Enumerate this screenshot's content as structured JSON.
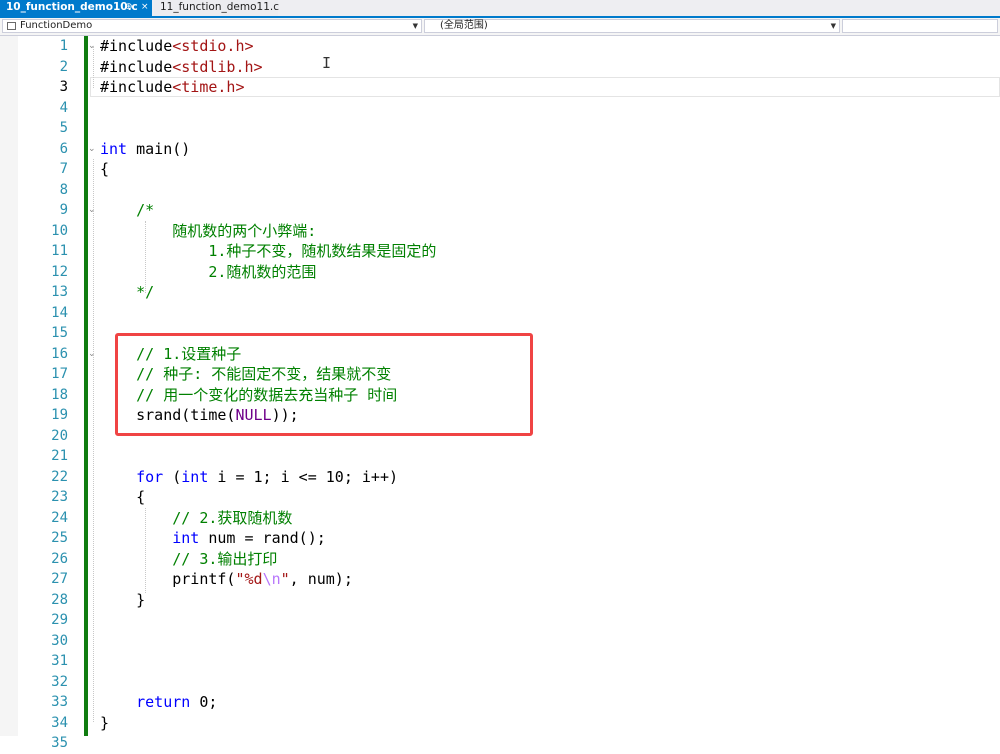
{
  "tabs": [
    {
      "label": "10_function_demo10.c",
      "pin": "⊕",
      "close": "×"
    },
    {
      "label": "11_function_demo11.c"
    }
  ],
  "nav": {
    "project": "FunctionDemo",
    "scope": "(全局范围)"
  },
  "lines": [
    [
      {
        "t": "#include",
        "c": ""
      },
      {
        "t": "<stdio.h>",
        "c": "inc"
      }
    ],
    [
      {
        "t": "#include",
        "c": ""
      },
      {
        "t": "<stdlib.h>",
        "c": "inc"
      }
    ],
    [
      {
        "t": "#include",
        "c": ""
      },
      {
        "t": "<time.h>",
        "c": "inc"
      }
    ],
    [],
    [],
    [
      {
        "t": "int",
        "c": "k"
      },
      {
        "t": " main()",
        "c": ""
      }
    ],
    [
      {
        "t": "{",
        "c": ""
      }
    ],
    [],
    [
      {
        "t": "    /*",
        "c": "cmt"
      }
    ],
    [
      {
        "t": "        随机数的两个小弊端:",
        "c": "cmt"
      }
    ],
    [
      {
        "t": "            1.种子不变，随机数结果是固定的",
        "c": "cmt"
      }
    ],
    [
      {
        "t": "            2.随机数的范围",
        "c": "cmt"
      }
    ],
    [
      {
        "t": "    */",
        "c": "cmt"
      }
    ],
    [],
    [],
    [
      {
        "t": "    // 1.设置种子",
        "c": "cmt"
      }
    ],
    [
      {
        "t": "    // 种子: 不能固定不变，结果就不变",
        "c": "cmt"
      }
    ],
    [
      {
        "t": "    // 用一个变化的数据去充当种子 时间",
        "c": "cmt"
      }
    ],
    [
      {
        "t": "    srand(time(",
        "c": ""
      },
      {
        "t": "NULL",
        "c": "mac"
      },
      {
        "t": "));",
        "c": ""
      }
    ],
    [],
    [],
    [
      {
        "t": "    ",
        "c": ""
      },
      {
        "t": "for",
        "c": "k"
      },
      {
        "t": " (",
        "c": ""
      },
      {
        "t": "int",
        "c": "k"
      },
      {
        "t": " i = 1; i <= 10; i++)",
        "c": ""
      }
    ],
    [
      {
        "t": "    {",
        "c": ""
      }
    ],
    [
      {
        "t": "        // 2.获取随机数",
        "c": "cmt"
      }
    ],
    [
      {
        "t": "        ",
        "c": ""
      },
      {
        "t": "int",
        "c": "k"
      },
      {
        "t": " num = rand();",
        "c": ""
      }
    ],
    [
      {
        "t": "        // 3.输出打印",
        "c": "cmt"
      }
    ],
    [
      {
        "t": "        printf(",
        "c": ""
      },
      {
        "t": "\"%d",
        "c": "str"
      },
      {
        "t": "\\n",
        "c": "esc"
      },
      {
        "t": "\"",
        "c": "str"
      },
      {
        "t": ", num);",
        "c": ""
      }
    ],
    [
      {
        "t": "    }",
        "c": ""
      }
    ],
    [],
    [],
    [],
    [],
    [
      {
        "t": "    ",
        "c": ""
      },
      {
        "t": "return",
        "c": "k"
      },
      {
        "t": " 0;",
        "c": ""
      }
    ],
    [
      {
        "t": "}",
        "c": ""
      }
    ],
    []
  ],
  "current_line": 3,
  "highlight_color": "#f04444",
  "change_bar_color": "#107c10"
}
